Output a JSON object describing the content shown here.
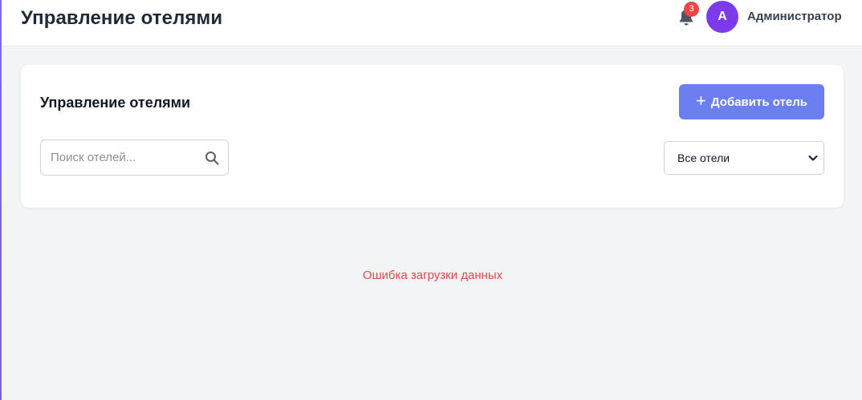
{
  "header": {
    "title": "Управление отелями",
    "notifications_count": "3",
    "avatar_initial": "A",
    "user_name": "Администратор"
  },
  "card": {
    "title": "Управление отелями",
    "add_button_label": "Добавить отель",
    "search_placeholder": "Поиск отелей...",
    "filter_selected": "Все отели"
  },
  "main": {
    "error_message": "Ошибка загрузки данных"
  },
  "icons": {
    "notifications": "bell-icon",
    "search": "search-icon",
    "add": "plus-icon",
    "dropdown": "chevron-down-icon"
  },
  "colors": {
    "primary_button": "#6b7ff0",
    "avatar_bg": "#7c3aed",
    "badge_bg": "#ef4444",
    "error_text": "#e04848",
    "page_bg": "#f3f4f6"
  }
}
